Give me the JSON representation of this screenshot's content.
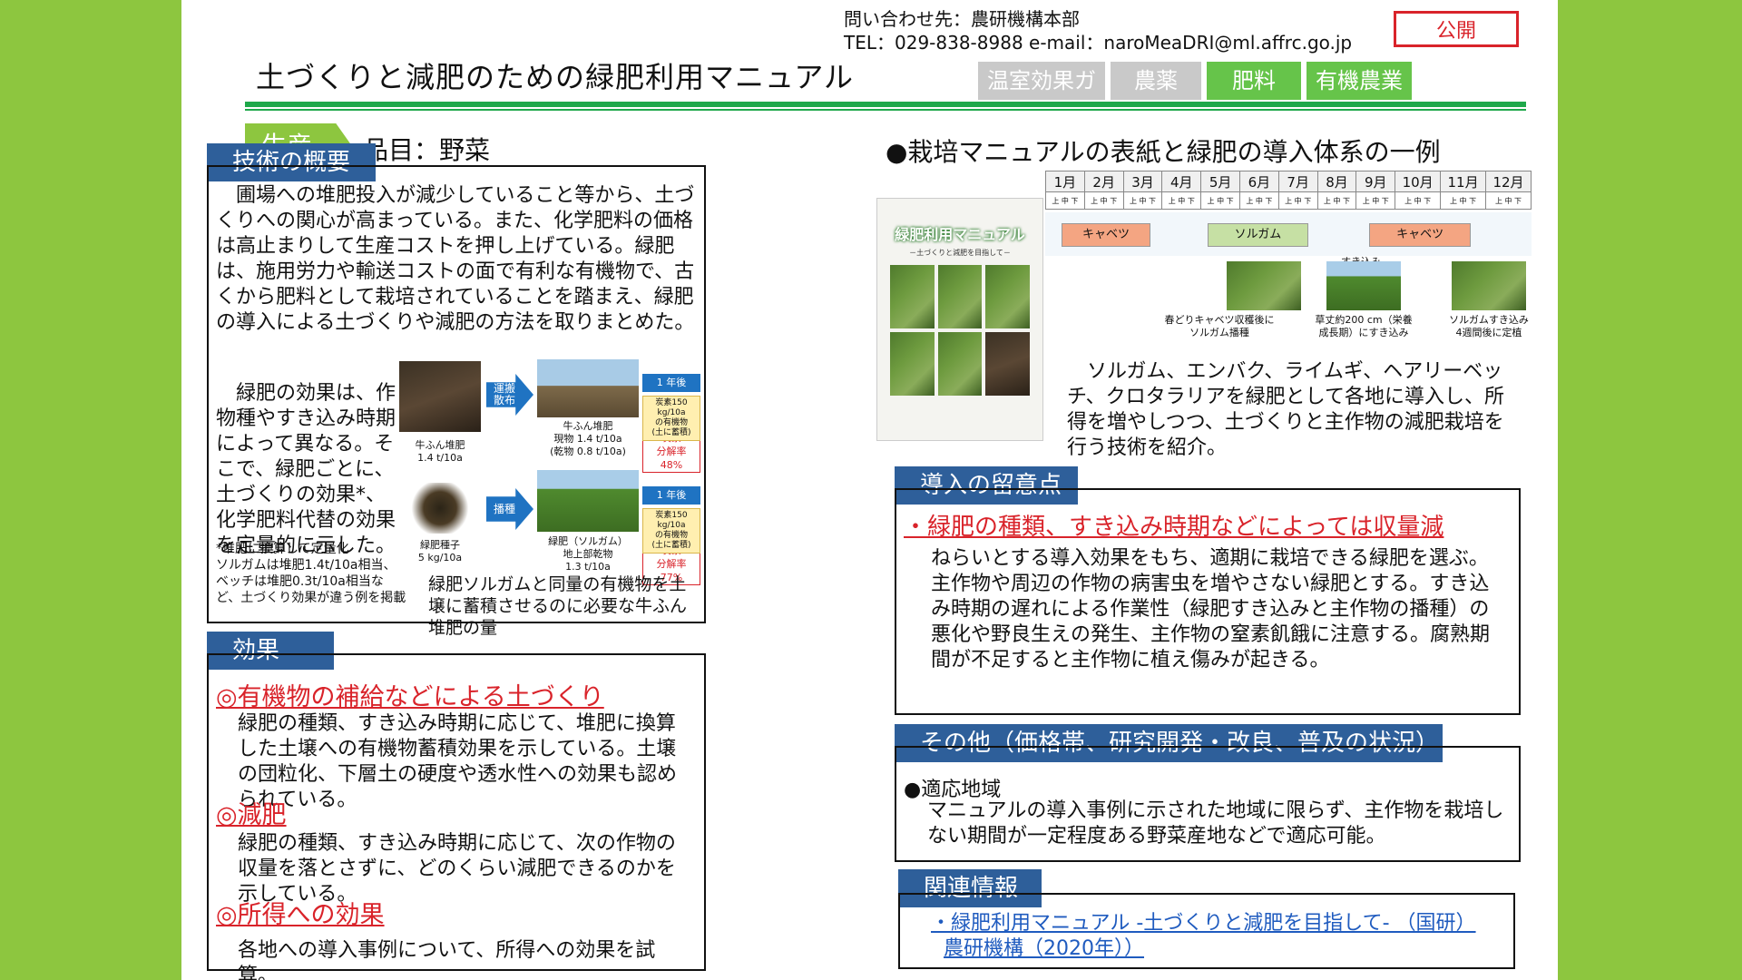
{
  "header": {
    "contact_line1": "問い合わせ先：農研機構本部",
    "contact_line2": "TEL：029-838-8988 e-mail：naroMeaDRI@ml.affrc.go.jp",
    "public_badge": "公開",
    "title": "土づくりと減肥のための緑肥利用マニュアル",
    "tabs": [
      {
        "label": "温室効果ガス",
        "color": "#c9c9c9"
      },
      {
        "label": "農薬",
        "color": "#c9c9c9"
      },
      {
        "label": "肥料",
        "color": "#66c44a"
      },
      {
        "label": "有機農業",
        "color": "#66c44a"
      }
    ]
  },
  "product": {
    "tag": "生産",
    "item": "品目：野菜"
  },
  "overview": {
    "heading": "技術の概要",
    "para1": "圃場への堆肥投入が減少していること等から、土づくりへの関心が高まっている。また、化学肥料の価格は高止まりして生産コストを押し上げている。緑肥は、施用労力や輸送コストの面で有利な有機物で、古くから肥料として栽培されていることを踏まえ、緑肥の導入による土づくりや減肥の方法を取りまとめた。",
    "para2": "緑肥の効果は、作物種やすき込み時期によって異なる。そこで、緑肥ごとに、土づくりの効果*、化学肥料代替の効果を定量的に示した。",
    "note": "*堆肥に換算して定量化\nソルガムは堆肥1.4t/10a相当、ベッチは堆肥0.3t/10a相当など、土づくり効果が違う例を掲載",
    "diagram": {
      "caption_manure": "牛ふん堆肥\n1.4 t/10a",
      "caption_seed": "緑肥種子\n5 kg/10a",
      "arrow_top": "運搬\n散布",
      "arrow_bottom": "播種",
      "caption_manure_field": "牛ふん堆肥\n現物 1.4 t/10a\n(乾物 0.8 t/10a)",
      "caption_sorghum": "緑肥（ソルガム）\n地上部乾物\n1.3 t/10a",
      "after_year_1": "1 年後",
      "after_year_2": "1 年後",
      "decomp_1": "炭素\n分解率\n48%",
      "decomp_2": "炭素\n分解率\n77%",
      "result_1": "炭素150 kg/10a\nの有機物\n(土に蓄積)",
      "result_2": "炭素150 kg/10a\nの有機物\n(土に蓄積)",
      "equal": "同量",
      "figure_caption": "緑肥ソルガムと同量の有機物を土壌に蓄積させるのに必要な牛ふん堆肥の量"
    }
  },
  "effects": {
    "heading": "効果",
    "items": [
      {
        "title": "◎有機物の補給などによる土づくり",
        "text": "緑肥の種類、すき込み時期に応じて、堆肥に換算した土壌への有機物蓄積効果を示している。土壌の団粒化、下層土の硬度や透水性への効果も認められている。"
      },
      {
        "title": "◎減肥",
        "text": "緑肥の種類、すき込み時期に応じて、次の作物の収量を落とさずに、どのくらい減肥できるのかを示している。"
      },
      {
        "title": "◎所得への効果",
        "text": "各地への導入事例について、所得への効果を試算。"
      }
    ]
  },
  "manual": {
    "heading": "●栽培マニュアルの表紙と緑肥の導入体系の一例",
    "cover_title": "緑肥利用マニュアル",
    "cover_subtitle": "－土づくりと減肥を目指して－",
    "months": [
      "1月",
      "2月",
      "3月",
      "4月",
      "5月",
      "6月",
      "7月",
      "8月",
      "9月",
      "10月",
      "11月",
      "12月"
    ],
    "bars": [
      {
        "label": "キャベツ",
        "start": 1.4,
        "end": 3.6,
        "kind": "crop"
      },
      {
        "label": "ソルガム",
        "start": 5.0,
        "end": 7.5,
        "kind": "green"
      },
      {
        "label": "キャベツ",
        "start": 9.0,
        "end": 11.5,
        "kind": "crop"
      }
    ],
    "photo_captions": [
      "春どりキャベツ収穫後に\nソルガム播種",
      "草丈約200 cm（栄養\n成長期）にすき込み",
      "ソルガムすき込み\n4週間後に定植"
    ],
    "plow_label": "すき込み",
    "description": "ソルガム、エンバク、ライムギ、ヘアリーベッチ、クロタラリアを緑肥として各地に導入し、所得を増やしつつ、土づくりと主作物の減肥栽培を行う技術を紹介。"
  },
  "cautions": {
    "heading": "導入の留意点",
    "red_title": "・緑肥の種類、すき込み時期などによっては収量減",
    "text": "ねらいとする導入効果をもち、適期に栽培できる緑肥を選ぶ。主作物や周辺の作物の病害虫を増やさない緑肥とする。すき込み時期の遅れによる作業性（緑肥すき込みと主作物の播種）の悪化や野良生えの発生、主作物の窒素飢餓に注意する。腐熟期間が不足すると主作物に植え傷みが起きる。"
  },
  "other": {
    "heading": "その他（価格帯、研究開発・改良、普及の状況）",
    "sub": "●適応地域",
    "text": "マニュアルの導入事例に示された地域に限らず、主作物を栽培しない期間が一定程度ある野菜産地などで適応可能。"
  },
  "related": {
    "heading": "関連情報",
    "link_line1": "・緑肥利用マニュアル -土づくりと減肥を目指して- （国研）",
    "link_line2": "農研機構（2020年））"
  }
}
